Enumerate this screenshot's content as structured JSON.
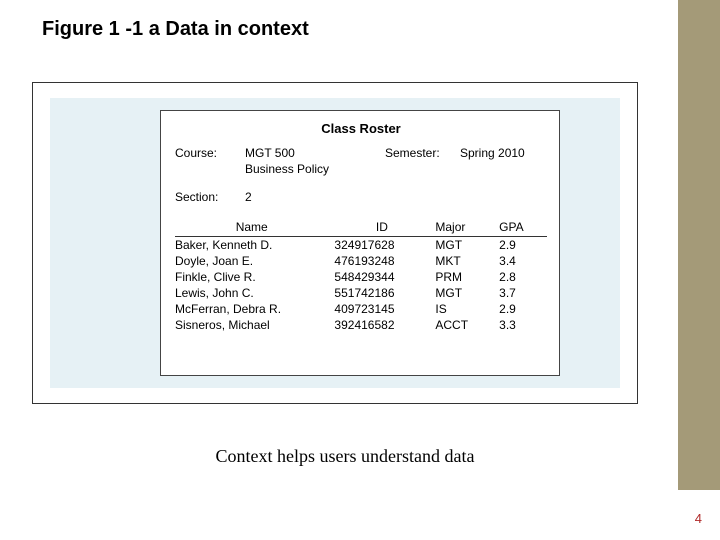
{
  "colors": {
    "sidebar": "#a49a78",
    "bluebox": "#e6f1f5",
    "pagenum": "#b02a2a"
  },
  "title": "Figure 1 -1 a Data in context",
  "roster": {
    "heading": "Class Roster",
    "course_label": "Course:",
    "course_code": "MGT 500",
    "course_name": "Business Policy",
    "semester_label": "Semester:",
    "semester_value": "Spring 2010",
    "section_label": "Section:",
    "section_value": "2",
    "columns": {
      "name": "Name",
      "id": "ID",
      "major": "Major",
      "gpa": "GPA"
    },
    "rows": [
      {
        "name": "Baker, Kenneth D.",
        "id": "324917628",
        "major": "MGT",
        "gpa": "2.9"
      },
      {
        "name": "Doyle, Joan E.",
        "id": "476193248",
        "major": "MKT",
        "gpa": "3.4"
      },
      {
        "name": "Finkle, Clive R.",
        "id": "548429344",
        "major": "PRM",
        "gpa": "2.8"
      },
      {
        "name": "Lewis, John C.",
        "id": "551742186",
        "major": "MGT",
        "gpa": "3.7"
      },
      {
        "name": "McFerran, Debra R.",
        "id": "409723145",
        "major": "IS",
        "gpa": "2.9"
      },
      {
        "name": "Sisneros, Michael",
        "id": "392416582",
        "major": "ACCT",
        "gpa": "3.3"
      }
    ]
  },
  "caption": "Context helps users understand data",
  "page_number": "4"
}
